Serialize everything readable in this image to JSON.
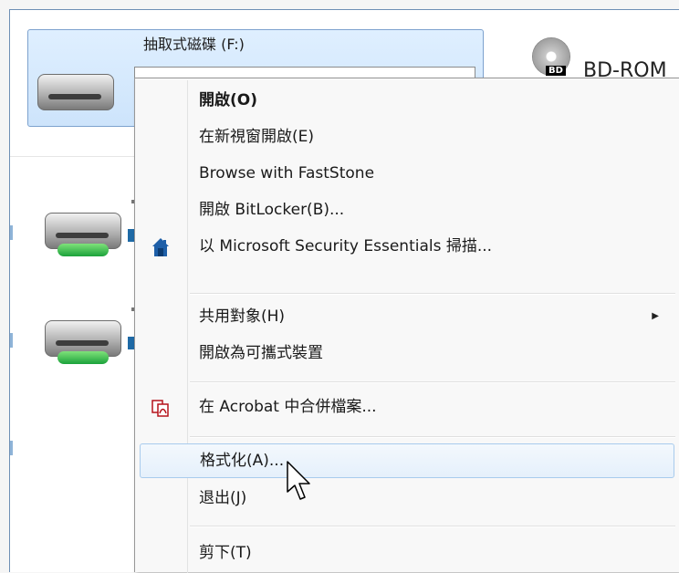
{
  "window": {
    "drive_title": "抽取式磁碟 (F:)",
    "bd_label": "BD",
    "bd_title": "BD-ROM"
  },
  "context_menu": {
    "items": [
      {
        "label": "開啟(O)",
        "bold": true
      },
      {
        "label": "在新視窗開啟(E)"
      },
      {
        "label": "Browse with FastStone"
      },
      {
        "label": "開啟 BitLocker(B)..."
      },
      {
        "label": "以 Microsoft Security Essentials 掃描...",
        "icon": "security-essentials-icon"
      },
      {
        "label": "共用對象(H)",
        "has_submenu": true
      },
      {
        "label": "開啟為可攜式裝置"
      },
      {
        "label": "在 Acrobat 中合併檔案...",
        "icon": "acrobat-combine-icon"
      },
      {
        "label": "格式化(A)...",
        "hovered": true
      },
      {
        "label": "退出(J)"
      },
      {
        "label": "剪下(T)"
      }
    ],
    "submenu_arrow": "▶"
  },
  "colors": {
    "selection_fill": "#dfefff",
    "selection_border": "#7da2ce",
    "menu_hover_border": "#a8cbed",
    "security_icon": "#1e5fa8",
    "acrobat_icon": "#b5121b"
  }
}
